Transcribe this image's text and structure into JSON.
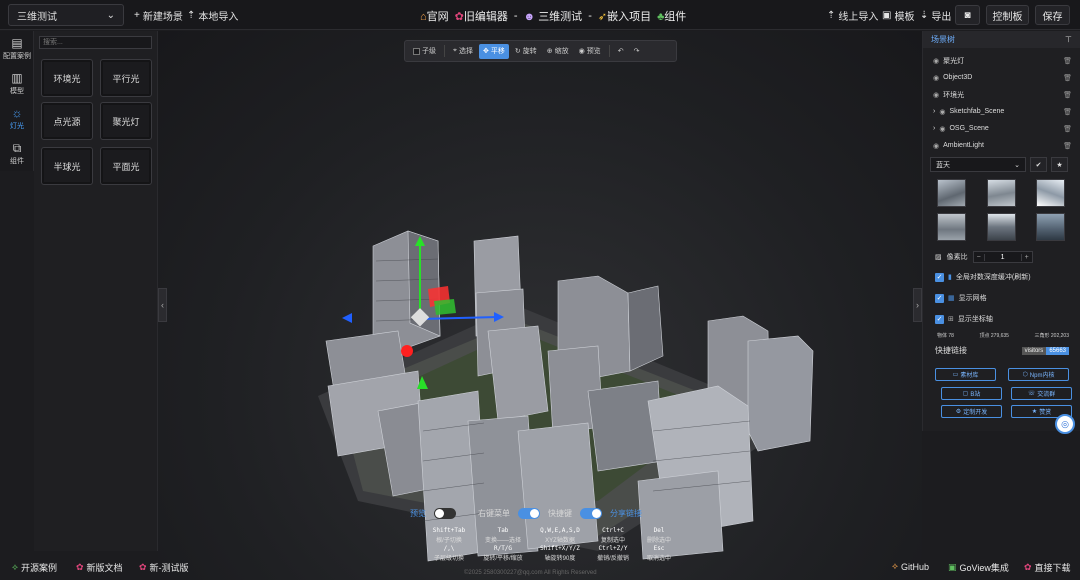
{
  "topbar": {
    "scene_select": "三维测试",
    "new_scene": "新建场景",
    "local_import": "本地导入",
    "center": [
      {
        "icon": "house-icon",
        "label": "官网"
      },
      {
        "icon": "leaf-icon",
        "label": "旧编辑器"
      },
      {
        "icon": "ghost-icon",
        "label": "三维测试"
      },
      {
        "icon": "rocket-icon",
        "label": "嵌入项目"
      },
      {
        "icon": "tree-icon",
        "label": "组件"
      }
    ],
    "online_import": "线上导入",
    "template": "模板",
    "export": "导出",
    "control_panel": "控制板",
    "save": "保存"
  },
  "left_rail": [
    {
      "label": "配置案例",
      "icon": "case-icon"
    },
    {
      "label": "模型",
      "icon": "model-icon"
    },
    {
      "label": "灯光",
      "icon": "sun-icon"
    },
    {
      "label": "组件",
      "icon": "component-icon"
    }
  ],
  "left_panel": {
    "search_placeholder": "搜索...",
    "lights": [
      "环境光",
      "平行光",
      "点光源",
      "聚光灯",
      "半球光",
      "平面光"
    ]
  },
  "toolbar": {
    "child": "子级",
    "select": "选择",
    "translate": "平移",
    "rotate": "旋转",
    "scale": "缩放",
    "preview": "预览"
  },
  "bottom": {
    "preview": "预览",
    "context_menu": "右键菜单",
    "shortcuts": "快捷键",
    "share": "分享链接",
    "keys": [
      {
        "k": "Shift+Tab",
        "d": "根/子切换"
      },
      {
        "k": "Tab",
        "d": "变换——选择"
      },
      {
        "k": "Q,W,E,A,S,D",
        "d": "XYZ轴数据"
      },
      {
        "k": "Ctrl+C",
        "d": "复制选中"
      },
      {
        "k": "Del",
        "d": "删除选中"
      },
      {
        "k": "/,\\",
        "d": "子层级切换"
      },
      {
        "k": "R/T/G",
        "d": "旋转/平移/缩放"
      },
      {
        "k": "Shift+X/Y/Z",
        "d": "轴旋转90度"
      },
      {
        "k": "Ctrl+Z/Y",
        "d": "撤销/反撤销"
      },
      {
        "k": "Esc",
        "d": "取消选中"
      }
    ],
    "copyright": "©2025 2580300227@qq.com All Rights Reserved"
  },
  "right_panel": {
    "title": "场景树",
    "tree": [
      {
        "label": "聚光灯",
        "expand": false
      },
      {
        "label": "Object3D",
        "expand": false
      },
      {
        "label": "环境光",
        "expand": false
      },
      {
        "label": "Sketchfab_Scene",
        "expand": true
      },
      {
        "label": "OSG_Scene",
        "expand": true
      },
      {
        "label": "AmbientLight",
        "expand": false
      }
    ],
    "sky_select": "蓝天",
    "pixel_ratio_label": "像素比",
    "pixel_ratio": "1",
    "checks": [
      "全局对数深度缓冲(刷新)",
      "显示网格",
      "显示坐标轴"
    ],
    "stats": {
      "objects": "物体 78",
      "vertices": "顶点 279,635",
      "triangles": "三角形 202,203"
    },
    "quick_links": "快捷链接",
    "visitors_label": "visitors",
    "visitors_value": "65663",
    "links": [
      "素材库",
      "Npm内核",
      "B站",
      "交流群",
      "定制开发",
      "赞赏"
    ]
  },
  "footer": {
    "left": [
      {
        "icon": "github-icon",
        "label": "开源案例"
      },
      {
        "icon": "leaf-icon",
        "label": "新版文档"
      },
      {
        "icon": "leaf-icon",
        "label": "新-测试版"
      }
    ],
    "right": [
      {
        "icon": "github-icon",
        "label": "GitHub"
      },
      {
        "icon": "goview-icon",
        "label": "GoView集成"
      },
      {
        "icon": "download-icon",
        "label": "直接下载"
      }
    ]
  },
  "colors": {
    "accent": "#4a90e2",
    "background": "#1c1c1f",
    "panel": "#1f1f22"
  }
}
